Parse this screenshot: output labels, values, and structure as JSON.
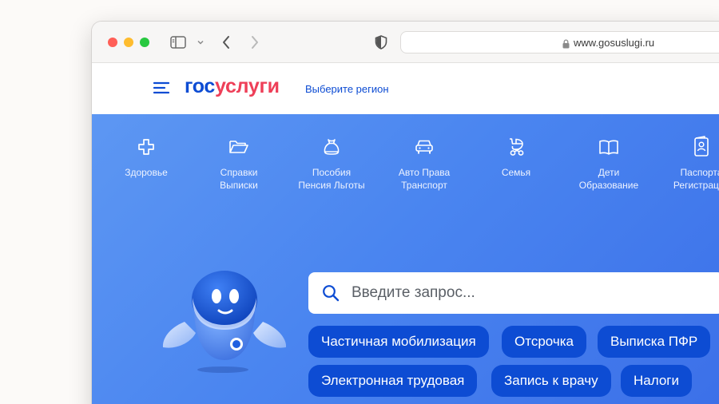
{
  "browser": {
    "url": "www.gosuslugi.ru"
  },
  "header": {
    "logo_part1": "гос",
    "logo_part2": "услуги",
    "region_link": "Выберите регион"
  },
  "categories": [
    {
      "icon": "plus-icon",
      "line1": "Здоровье",
      "line2": ""
    },
    {
      "icon": "folder-icon",
      "line1": "Справки",
      "line2": "Выписки"
    },
    {
      "icon": "money-bag-icon",
      "line1": "Пособия",
      "line2": "Пенсия Льготы"
    },
    {
      "icon": "car-icon",
      "line1": "Авто Права",
      "line2": "Транспорт"
    },
    {
      "icon": "stroller-icon",
      "line1": "Семья",
      "line2": ""
    },
    {
      "icon": "book-icon",
      "line1": "Дети",
      "line2": "Образование"
    },
    {
      "icon": "passport-icon",
      "line1": "Паспорта",
      "line2": "Регистрация"
    }
  ],
  "search": {
    "placeholder": "Введите запрос..."
  },
  "chips": [
    "Частичная мобилизация",
    "Отсрочка",
    "Выписка ПФР",
    "Электронная трудовая",
    "Запись к врачу",
    "Налоги"
  ],
  "colors": {
    "brand_blue": "#0d4cd3",
    "brand_red": "#ee3f58",
    "hero_blue": "#4a85f0"
  }
}
